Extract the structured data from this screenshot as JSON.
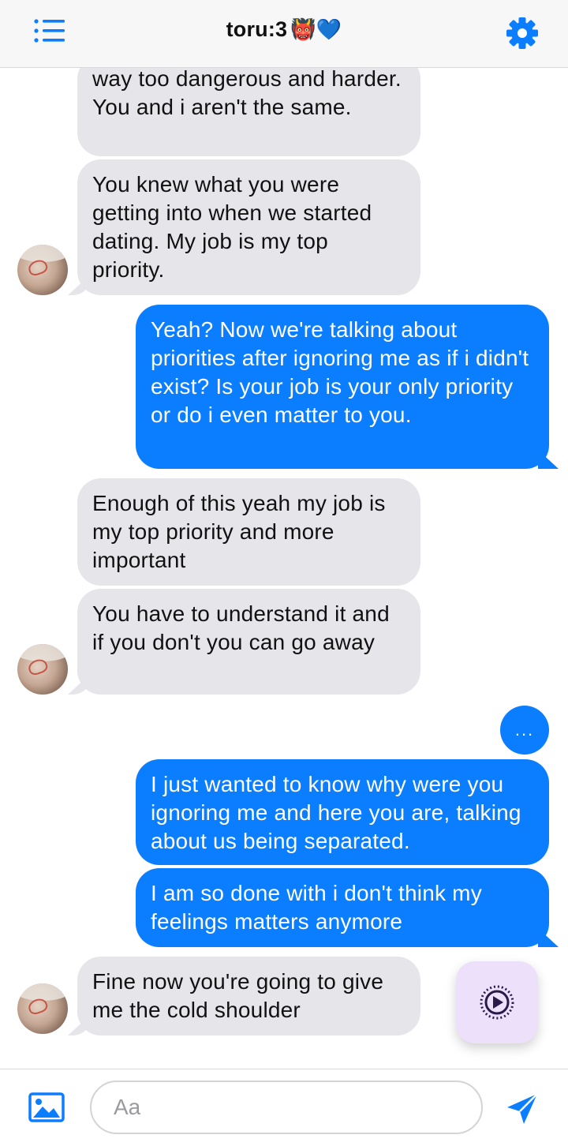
{
  "header": {
    "title": "toru:3",
    "title_emoji": "👹💙",
    "menu_icon": "list-icon",
    "settings_icon": "gear-icon"
  },
  "colors": {
    "accent": "#0b7dff",
    "incoming_bubble": "#e6e5ea",
    "fab_background": "#ece0fb"
  },
  "messages": [
    {
      "side": "in",
      "text": "way too dangerous and harder. You and i aren't the same."
    },
    {
      "side": "in",
      "text": "You knew what you were getting into when we started dating. My job is my top priority."
    },
    {
      "side": "out",
      "text": "Yeah? Now we're talking about priorities after ignoring me as if i didn't exist? Is your job is your only priority or do i even matter to you."
    },
    {
      "side": "in",
      "text": "Enough of this yeah my job is my top priority and more important"
    },
    {
      "side": "in",
      "text": "You have to understand it and if you don't you can go away"
    },
    {
      "side": "out",
      "text": "I just wanted to know why were you ignoring me and here you are, talking about us being separated."
    },
    {
      "side": "out",
      "text": "I am so done with i don't think my feelings matters anymore"
    },
    {
      "side": "in",
      "text": "Fine now you're going to give me the cold shoulder"
    }
  ],
  "typing_indicator": "...",
  "composer": {
    "placeholder": "Aa",
    "photo_icon": "image-icon",
    "send_icon": "send-icon"
  },
  "fab_icon": "play-icon"
}
